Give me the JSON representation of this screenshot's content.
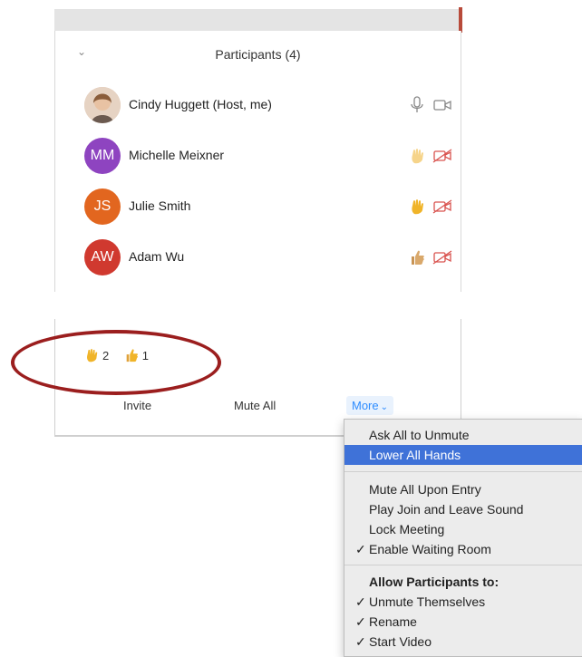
{
  "header": {
    "title": "Participants (4)"
  },
  "participants": [
    {
      "name": "Cindy Huggett (Host, me)",
      "initials": "",
      "avatar_color": "#b88a6e"
    },
    {
      "name": "Michelle Meixner",
      "initials": "MM",
      "avatar_color": "#8e44c0"
    },
    {
      "name": "Julie Smith",
      "initials": "JS",
      "avatar_color": "#e2661f"
    },
    {
      "name": "Adam Wu",
      "initials": "AW",
      "avatar_color": "#d0392f"
    }
  ],
  "reactions": {
    "raised_hands": "2",
    "thumbs_up": "1"
  },
  "footer": {
    "invite": "Invite",
    "mute_all": "Mute All",
    "more": "More"
  },
  "menu": {
    "ask_all_unmute": "Ask All to Unmute",
    "lower_all_hands": "Lower All Hands",
    "mute_upon_entry": "Mute All Upon Entry",
    "play_sound": "Play Join and Leave Sound",
    "lock_meeting": "Lock Meeting",
    "waiting_room": "Enable Waiting Room",
    "allow_header": "Allow Participants to:",
    "unmute_themselves": "Unmute Themselves",
    "rename": "Rename",
    "start_video": "Start Video",
    "check": "✓"
  },
  "colors": {
    "accent": "#2d8cff",
    "highlight": "#3f72d8",
    "annotation": "#9b1e1e",
    "hand": "#f0b429"
  }
}
